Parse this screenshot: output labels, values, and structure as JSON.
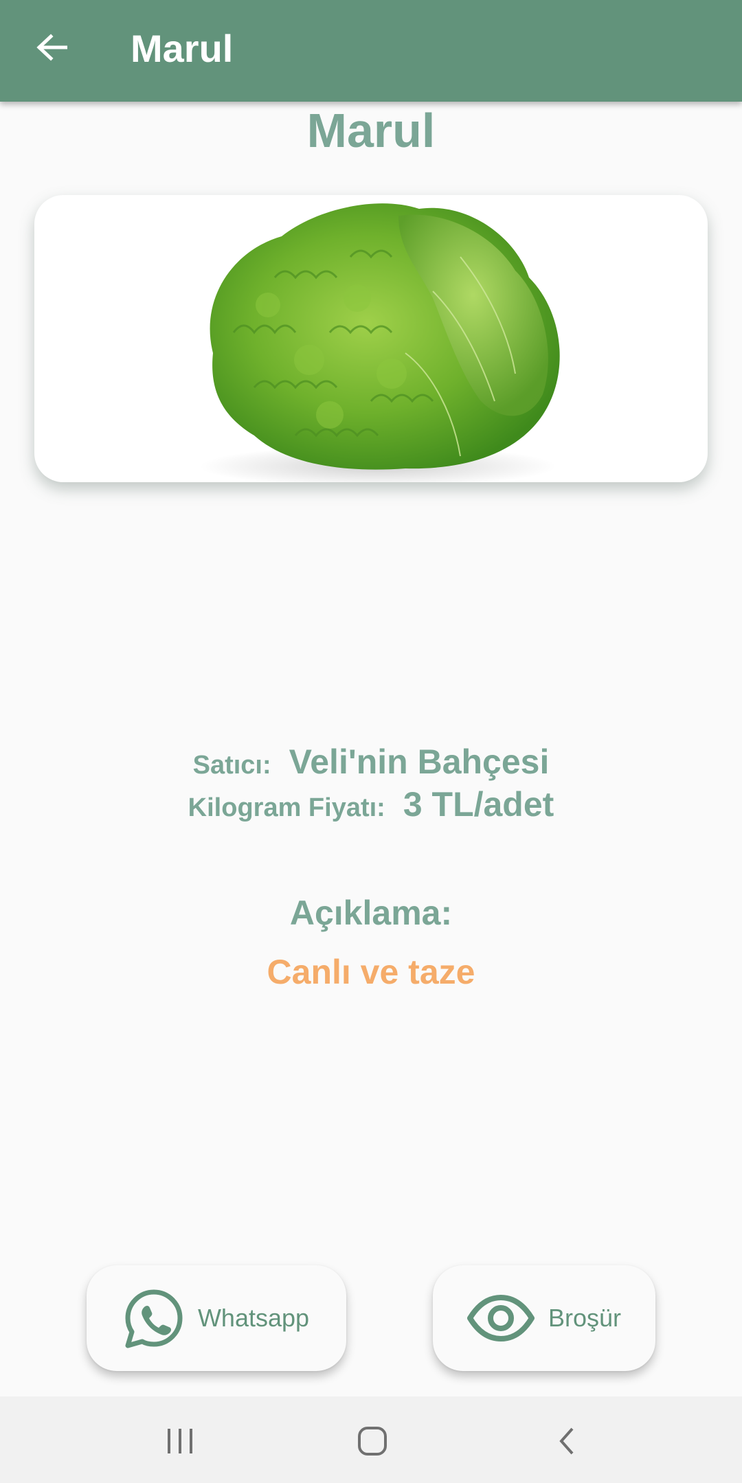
{
  "app_bar": {
    "title": "Marul",
    "back_icon": "arrow-left-icon",
    "background": "#62937b"
  },
  "product": {
    "name": "Marul",
    "image": "lettuce-photo"
  },
  "details": {
    "seller_label": "Satıcı:",
    "seller_value": "Veli'nin Bahçesi",
    "price_label": "Kilogram Fiyatı:",
    "price_value": "3 TL/adet"
  },
  "description": {
    "label": "Açıklama:",
    "value": "Canlı ve taze",
    "value_color": "#f5ac6a"
  },
  "actions": {
    "whatsapp_label": "Whatsapp",
    "whatsapp_icon": "whatsapp-icon",
    "brochure_label": "Broşür",
    "brochure_icon": "eye-icon"
  },
  "system_nav": {
    "recents_icon": "recents-icon",
    "home_icon": "home-icon",
    "back_icon": "back-chevron-icon"
  }
}
